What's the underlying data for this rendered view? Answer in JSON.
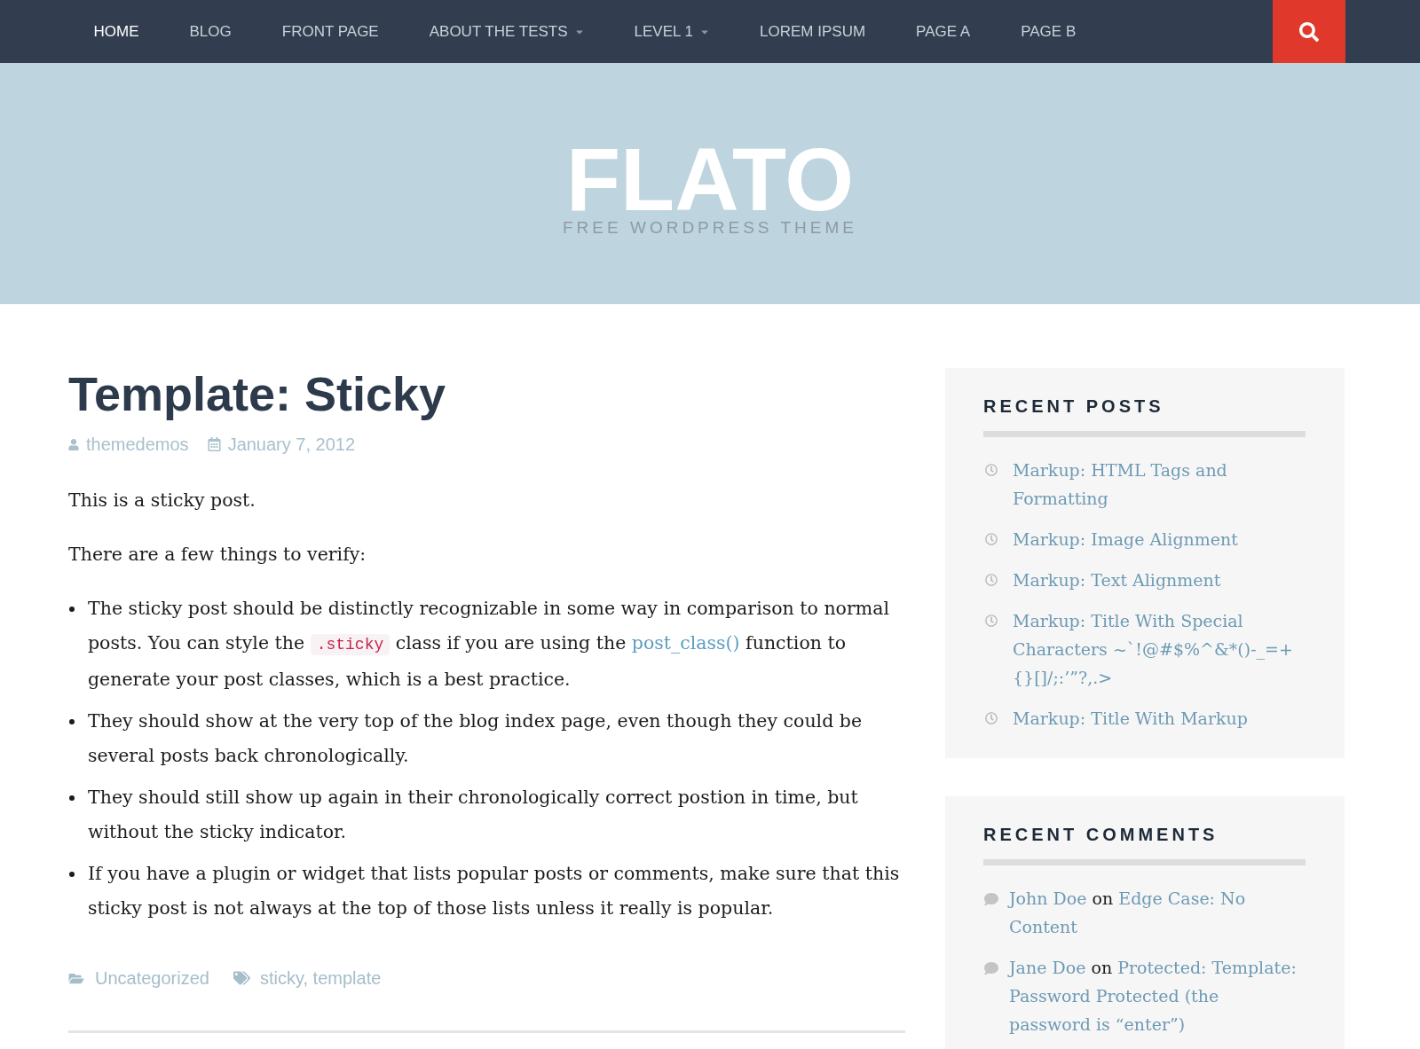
{
  "nav": {
    "items": [
      {
        "label": "HOME",
        "selected": true,
        "has_submenu": false
      },
      {
        "label": "BLOG",
        "selected": false,
        "has_submenu": false
      },
      {
        "label": "FRONT PAGE",
        "selected": false,
        "has_submenu": false
      },
      {
        "label": "ABOUT THE TESTS",
        "selected": false,
        "has_submenu": true
      },
      {
        "label": "LEVEL 1",
        "selected": false,
        "has_submenu": true
      },
      {
        "label": "LOREM IPSUM",
        "selected": false,
        "has_submenu": false
      },
      {
        "label": "PAGE A",
        "selected": false,
        "has_submenu": false
      },
      {
        "label": "PAGE B",
        "selected": false,
        "has_submenu": false
      }
    ]
  },
  "header": {
    "site_title": "FLATO",
    "tagline": "FREE WORDPRESS THEME"
  },
  "post": {
    "title": "Template: Sticky",
    "author": "themedemos",
    "date": "January 7, 2012",
    "paragraphs": [
      "This is a sticky post.",
      "There are a few things to verify:"
    ],
    "list": [
      {
        "segments": [
          {
            "kind": "text",
            "text": "The sticky post should be distinctly recognizable in some way in comparison to normal posts. You can style the "
          },
          {
            "kind": "code",
            "text": ".sticky"
          },
          {
            "kind": "text",
            "text": " class if you are using the "
          },
          {
            "kind": "link",
            "text": "post_class()"
          },
          {
            "kind": "text",
            "text": " function to generate your post classes, which is a best practice."
          }
        ]
      },
      {
        "segments": [
          {
            "kind": "text",
            "text": "They should show at the very top of the blog index page, even though they could be several posts back chronologically."
          }
        ]
      },
      {
        "segments": [
          {
            "kind": "text",
            "text": "They should still show up again in their chronologically correct postion in time, but without the sticky indicator."
          }
        ]
      },
      {
        "segments": [
          {
            "kind": "text",
            "text": "If you have a plugin or widget that lists popular posts or comments, make sure that this sticky post is not always at the top of those lists unless it really is popular."
          }
        ]
      }
    ],
    "category": "Uncategorized",
    "tags": "sticky, template"
  },
  "sidebar": {
    "widgets": [
      {
        "kind": "posts",
        "title": "RECENT POSTS",
        "items": [
          {
            "title": "Markup: HTML Tags and Formatting"
          },
          {
            "title": "Markup: Image Alignment"
          },
          {
            "title": "Markup: Text Alignment"
          },
          {
            "title": "Markup: Title With Special Characters ~`!@#$%^&*()-_=+{}[]/;:’”?,.>"
          },
          {
            "title": "Markup: Title With Markup"
          }
        ]
      },
      {
        "kind": "comments",
        "title": "RECENT COMMENTS",
        "items": [
          {
            "author": "John Doe",
            "connector": "on",
            "post": "Edge Case: No Content"
          },
          {
            "author": "Jane Doe",
            "connector": "on",
            "post": "Protected: Template: Password Protected (the password is “enter”)"
          }
        ]
      }
    ]
  }
}
